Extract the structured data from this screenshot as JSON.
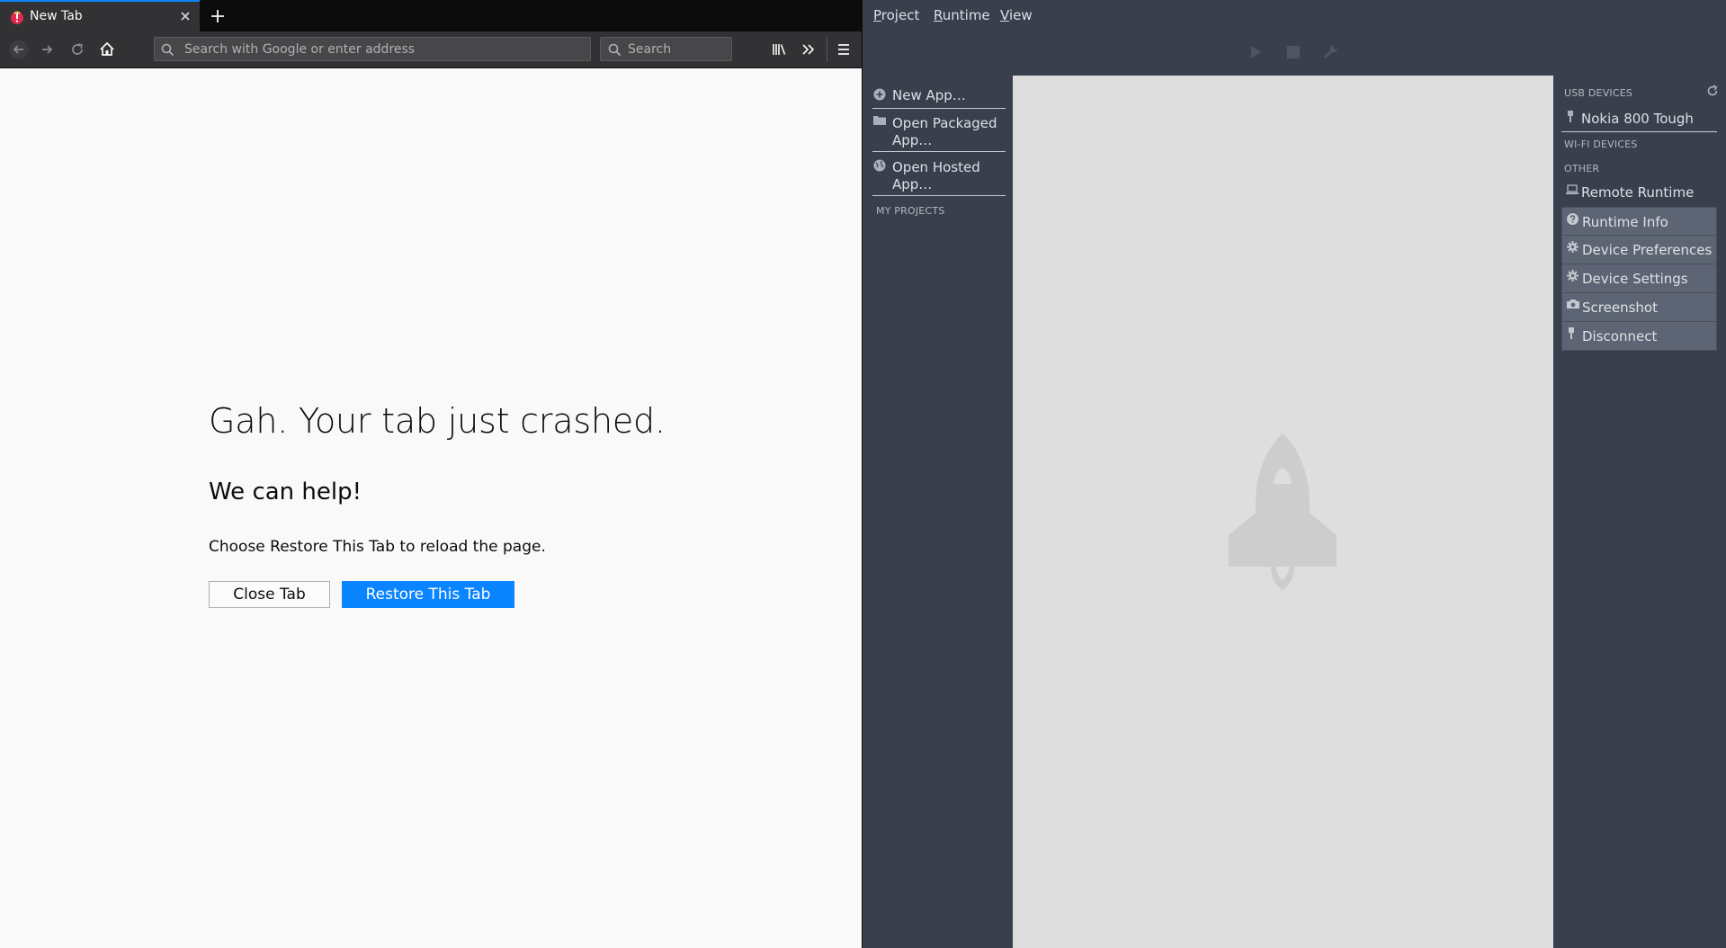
{
  "browser": {
    "tab": {
      "title": "New Tab"
    },
    "urlbar": {
      "placeholder": "Search with Google or enter address"
    },
    "searchbar": {
      "placeholder": "Search"
    },
    "crash_page": {
      "title": "Gah. Your tab just crashed.",
      "subtitle": "We can help!",
      "description": "Choose Restore This Tab to reload the page.",
      "close_button": "Close Tab",
      "restore_button": "Restore This Tab"
    },
    "colors": {
      "accent": "#0a84ff",
      "toolbar": "#323234",
      "tabbar": "#0c0c0d",
      "content_bg": "#f9f9fa"
    }
  },
  "webide": {
    "menu": [
      {
        "first": "P",
        "rest": "roject"
      },
      {
        "first": "R",
        "rest": "untime"
      },
      {
        "first": "V",
        "rest": "iew"
      }
    ],
    "toolbar": {
      "icons": [
        "play-icon",
        "stop-icon",
        "wrench-icon"
      ]
    },
    "projects": {
      "items": [
        {
          "label": "New App…",
          "icon": "plus-circle-icon"
        },
        {
          "label": "Open Packaged App…",
          "icon": "folder-icon"
        },
        {
          "label": "Open Hosted App…",
          "icon": "globe-icon"
        }
      ],
      "heading": "MY PROJECTS"
    },
    "runtimes": {
      "usb_heading": "USB DEVICES",
      "usb_devices": [
        {
          "label": "Nokia 800 Tough",
          "icon": "usb-plug-icon"
        }
      ],
      "wifi_heading": "WI-FI DEVICES",
      "other_heading": "OTHER",
      "other": [
        {
          "label": "Remote Runtime",
          "icon": "laptop-icon"
        }
      ],
      "actions": [
        {
          "label": "Runtime Info",
          "icon": "question-icon"
        },
        {
          "label": "Device Preferences",
          "icon": "gear-icon"
        },
        {
          "label": "Device Settings",
          "icon": "gear-icon"
        },
        {
          "label": "Screenshot",
          "icon": "camera-icon"
        },
        {
          "label": "Disconnect",
          "icon": "usb-plug-icon"
        }
      ]
    },
    "colors": {
      "panel": "#393f4c",
      "center": "#dedede",
      "action_bg": "#5d6473",
      "text": "#dbe0e5"
    }
  }
}
